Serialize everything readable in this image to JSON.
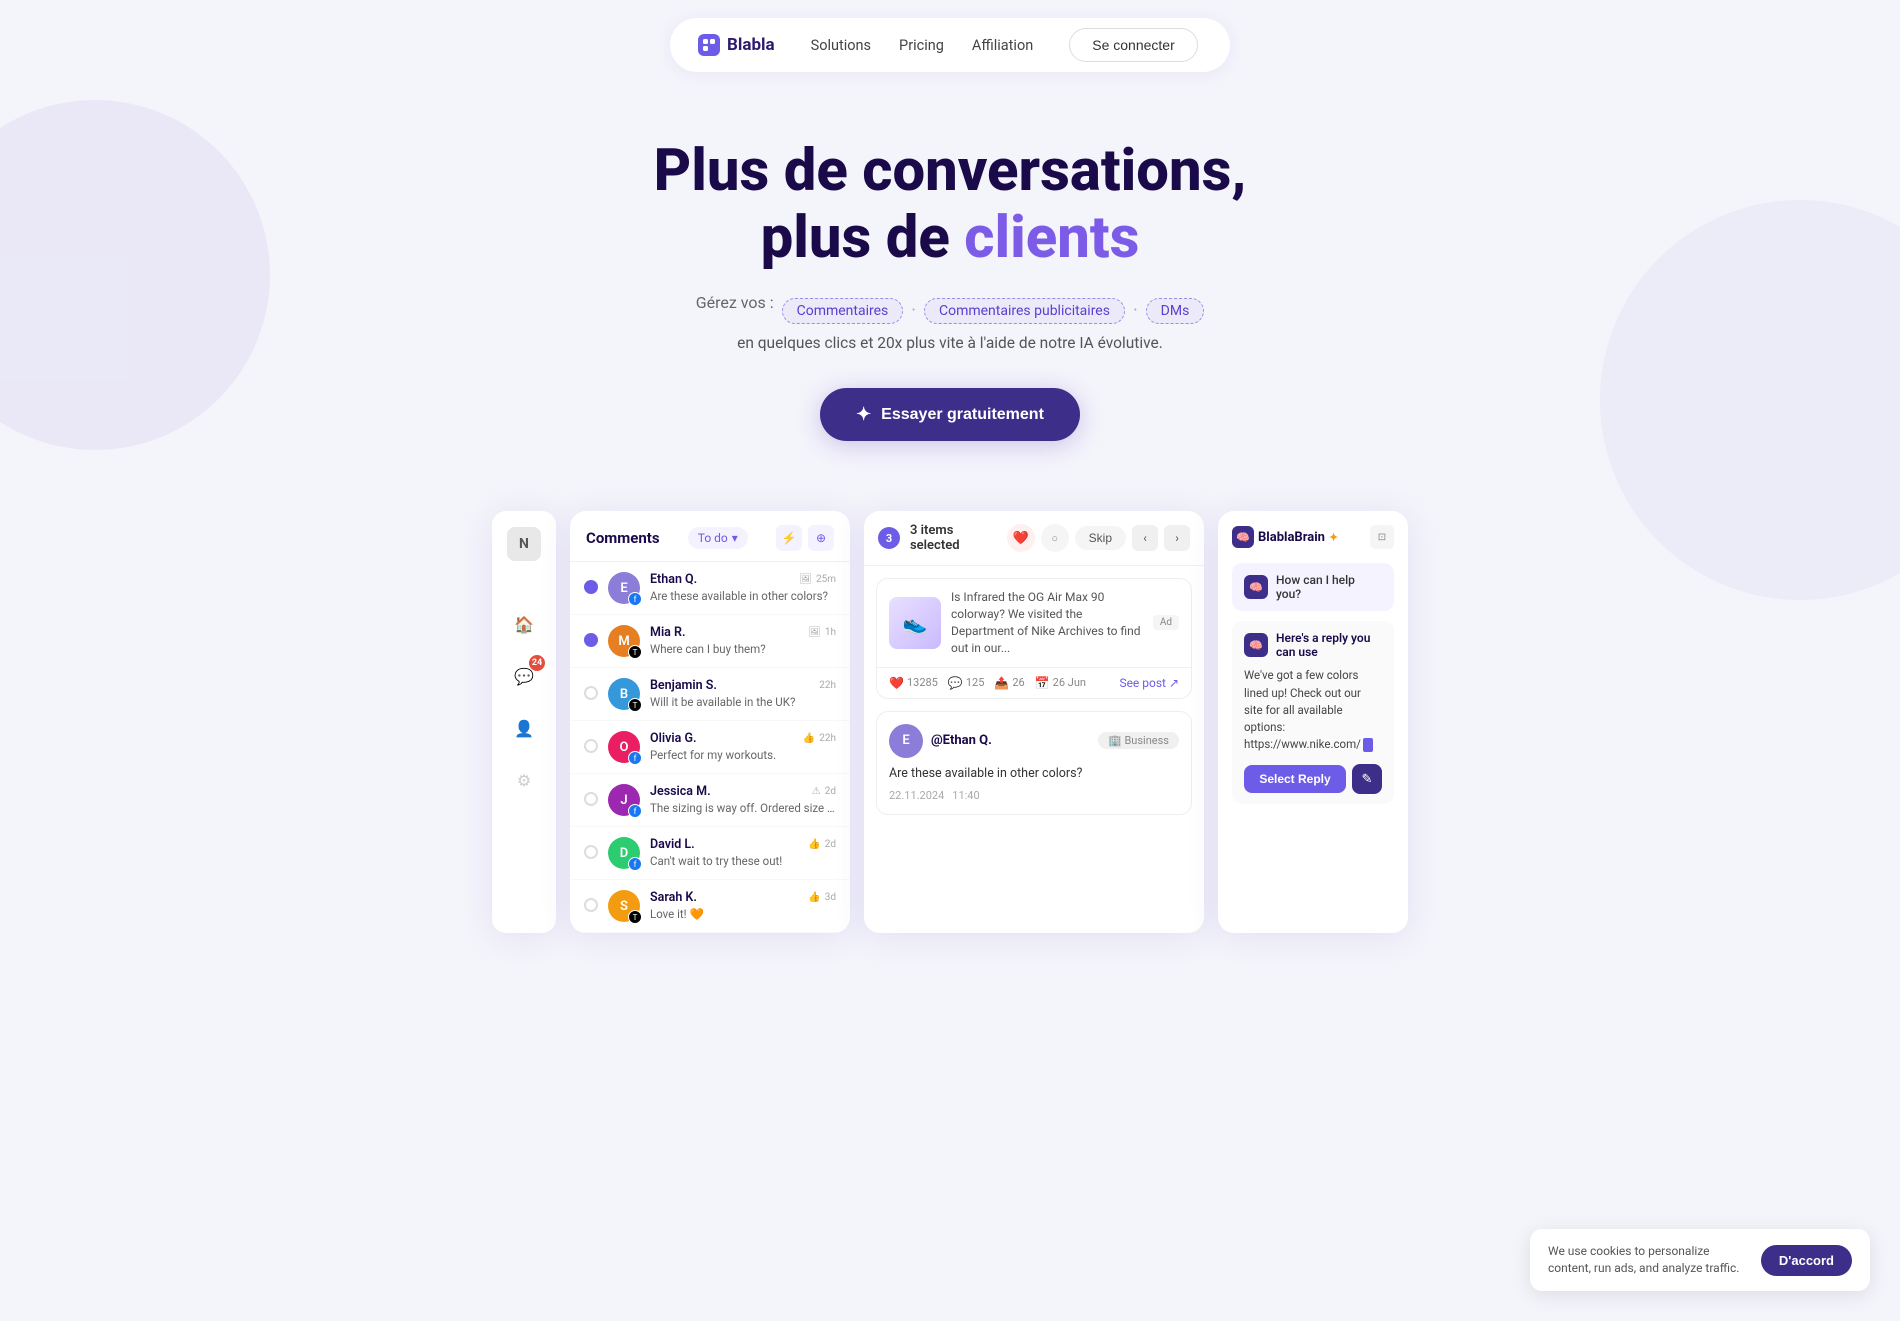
{
  "navbar": {
    "logo_text": "Blabla",
    "nav_items": [
      "Solutions",
      "Pricing",
      "Affiliation"
    ],
    "connect_btn": "Se connecter"
  },
  "hero": {
    "title_line1": "Plus de conversations,",
    "title_line2_prefix": "plus de ",
    "title_line2_highlight": "clients",
    "subtitle_prefix": "Gérez vos :",
    "badge1": "Commentaires",
    "badge2": "Commentaires publicitaires",
    "badge3": "DMs",
    "subtitle2": "en quelques clics et 20x plus vite à l'aide de notre IA évolutive.",
    "cta_btn": "Essayer gratuitement"
  },
  "mockup": {
    "sidebar": {
      "letter": "N",
      "badge_count": "24"
    },
    "comments_panel": {
      "title": "Comments",
      "filter": "To do",
      "items": [
        {
          "name": "Ethan Q.",
          "text": "Are these available in other colors?",
          "time": "25m",
          "avatar_color": "#8b7dd8",
          "platform": "fb",
          "checked": true
        },
        {
          "name": "Mia R.",
          "text": "Where can I buy them?",
          "time": "1h",
          "avatar_color": "#e67e22",
          "platform": "tiktok",
          "checked": true
        },
        {
          "name": "Benjamin S.",
          "text": "Will it be available in the UK?",
          "time": "22h",
          "avatar_color": "#3498db",
          "platform": "tiktok",
          "checked": false
        },
        {
          "name": "Olivia G.",
          "text": "Perfect for my workouts.",
          "time": "22h",
          "avatar_color": "#e91e63",
          "platform": "fb",
          "checked": false
        },
        {
          "name": "Jessica M.",
          "text": "The sizing is way off. Ordered size 9 b...",
          "time": "2d",
          "avatar_color": "#9c27b0",
          "platform": "fb",
          "checked": false
        },
        {
          "name": "David L.",
          "text": "Can't wait to try these out!",
          "time": "2d",
          "avatar_color": "#2ecc71",
          "platform": "fb",
          "checked": false
        },
        {
          "name": "Sarah K.",
          "text": "Love it! 🧡",
          "time": "3d",
          "avatar_color": "#f39c12",
          "platform": "tiktok",
          "checked": false
        }
      ]
    },
    "middle_panel": {
      "count": "3",
      "selected_text": "3 items selected",
      "skip_btn": "Skip",
      "post": {
        "desc": "Is Infrared the OG Air Max 90 colorway? We visited the Department of Nike Archives to find out in our...",
        "ad_label": "Ad",
        "stats": {
          "likes": "13285",
          "comments": "125",
          "shares": "26",
          "date": "26 Jun"
        },
        "see_post": "See post ↗"
      },
      "comment_detail": {
        "name": "@Ethan Q.",
        "tag": "Business",
        "text": "Are these available in other colors?",
        "date": "22.11.2024",
        "time": "11:40"
      }
    },
    "ai_panel": {
      "brand": "BlablaBrain",
      "brand_star": "✦",
      "help_text": "How can I help you?",
      "reply_label": "Here's a reply you can use",
      "reply_body": "We've got a few colors lined up! Check out our site for all available options: https://www.nike.com/",
      "select_reply_btn": "Select Reply",
      "edit_icon": "✎"
    },
    "cookie_bar": {
      "text": "We use cookies to personalize content, run ads, and analyze traffic.",
      "btn": "D'accord"
    }
  }
}
